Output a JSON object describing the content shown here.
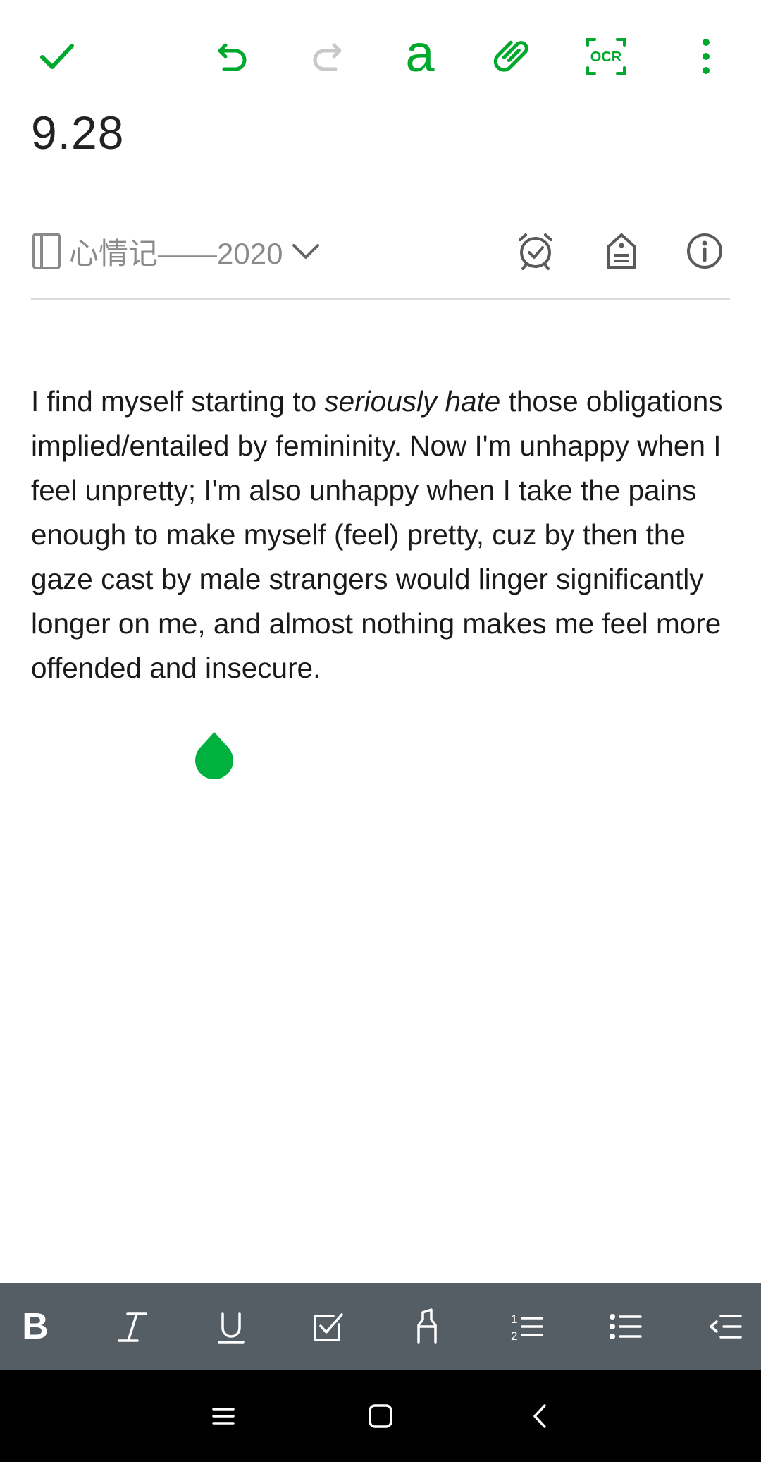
{
  "colors": {
    "accent": "#00a82d",
    "accent_disabled": "#c8c8c8",
    "meta_icon": "#5a5a5a",
    "format_bar": "#555d65"
  },
  "toolbar": {
    "done_icon": "check-icon",
    "undo_icon": "undo-icon",
    "redo_icon": "redo-icon",
    "text_format_icon": "text-format-icon",
    "attach_icon": "paperclip-icon",
    "ocr_label": "OCR",
    "more_icon": "more-vertical-icon"
  },
  "note": {
    "title": "9.28",
    "notebook": "心情记——2020",
    "body_parts": {
      "p1": "I find myself starting to ",
      "italic": "seriously hate",
      "p2": " those obligations implied/entailed by femininity. Now I'm unhappy when I feel unpretty; I'm also unhappy when I take the pains enough to make myself (feel) pretty, cuz by then the gaze cast by male strangers would linger significantly longer on me, and almost nothing makes me feel more offended and insecure."
    }
  },
  "meta_icons": [
    "reminder-icon",
    "tag-icon",
    "info-icon"
  ],
  "format_bar": [
    "bold",
    "italic",
    "underline",
    "checkbox",
    "highlighter",
    "numbered-list",
    "bulleted-list",
    "outdent"
  ],
  "nav": [
    "menu-icon",
    "home-icon",
    "back-icon"
  ]
}
